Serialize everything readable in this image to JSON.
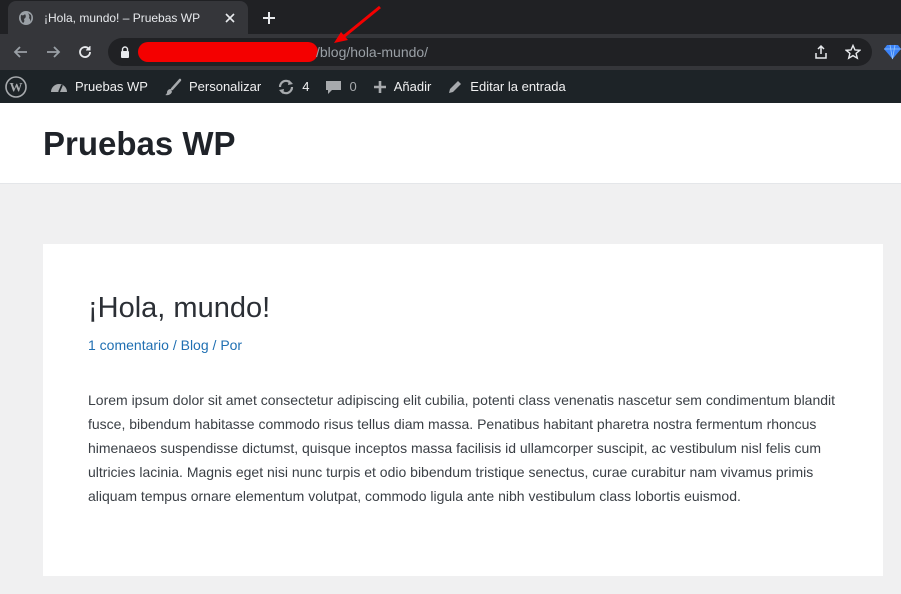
{
  "browser": {
    "tab_title": "¡Hola, mundo! – Pruebas WP",
    "url_path": "/blog/hola-mundo/"
  },
  "admin_bar": {
    "site_name": "Pruebas WP",
    "customize": "Personalizar",
    "updates_count": "4",
    "comments_count": "0",
    "add_new": "Añadir",
    "edit_post": "Editar la entrada"
  },
  "site": {
    "title": "Pruebas WP"
  },
  "post": {
    "title": "¡Hola, mundo!",
    "meta_comments": "1 comentario",
    "meta_sep1": " / ",
    "meta_category": "Blog",
    "meta_sep2": " / ",
    "meta_author": "Por",
    "body": "Lorem ipsum dolor sit amet consectetur adipiscing elit cubilia, potenti class venenatis nascetur sem condimentum blandit fusce, bibendum habitasse commodo risus tellus diam massa. Penatibus habitant pharetra nostra fermentum rhoncus himenaeos suspendisse dictumst, quisque inceptos massa facilisis id ullamcorper suscipit, ac vestibulum nisl felis cum ultricies lacinia. Magnis eget nisi nunc turpis et odio bibendum tristique senectus, curae curabitur nam vivamus primis aliquam tempus ornare elementum volutpat, commodo ligula ante nibh vestibulum class lobortis euismod."
  },
  "colors": {
    "browser_frame": "#202124",
    "toolbar": "#35363a",
    "admin_bar": "#1d2327",
    "link": "#1f6fb2",
    "redaction": "#f40000"
  }
}
